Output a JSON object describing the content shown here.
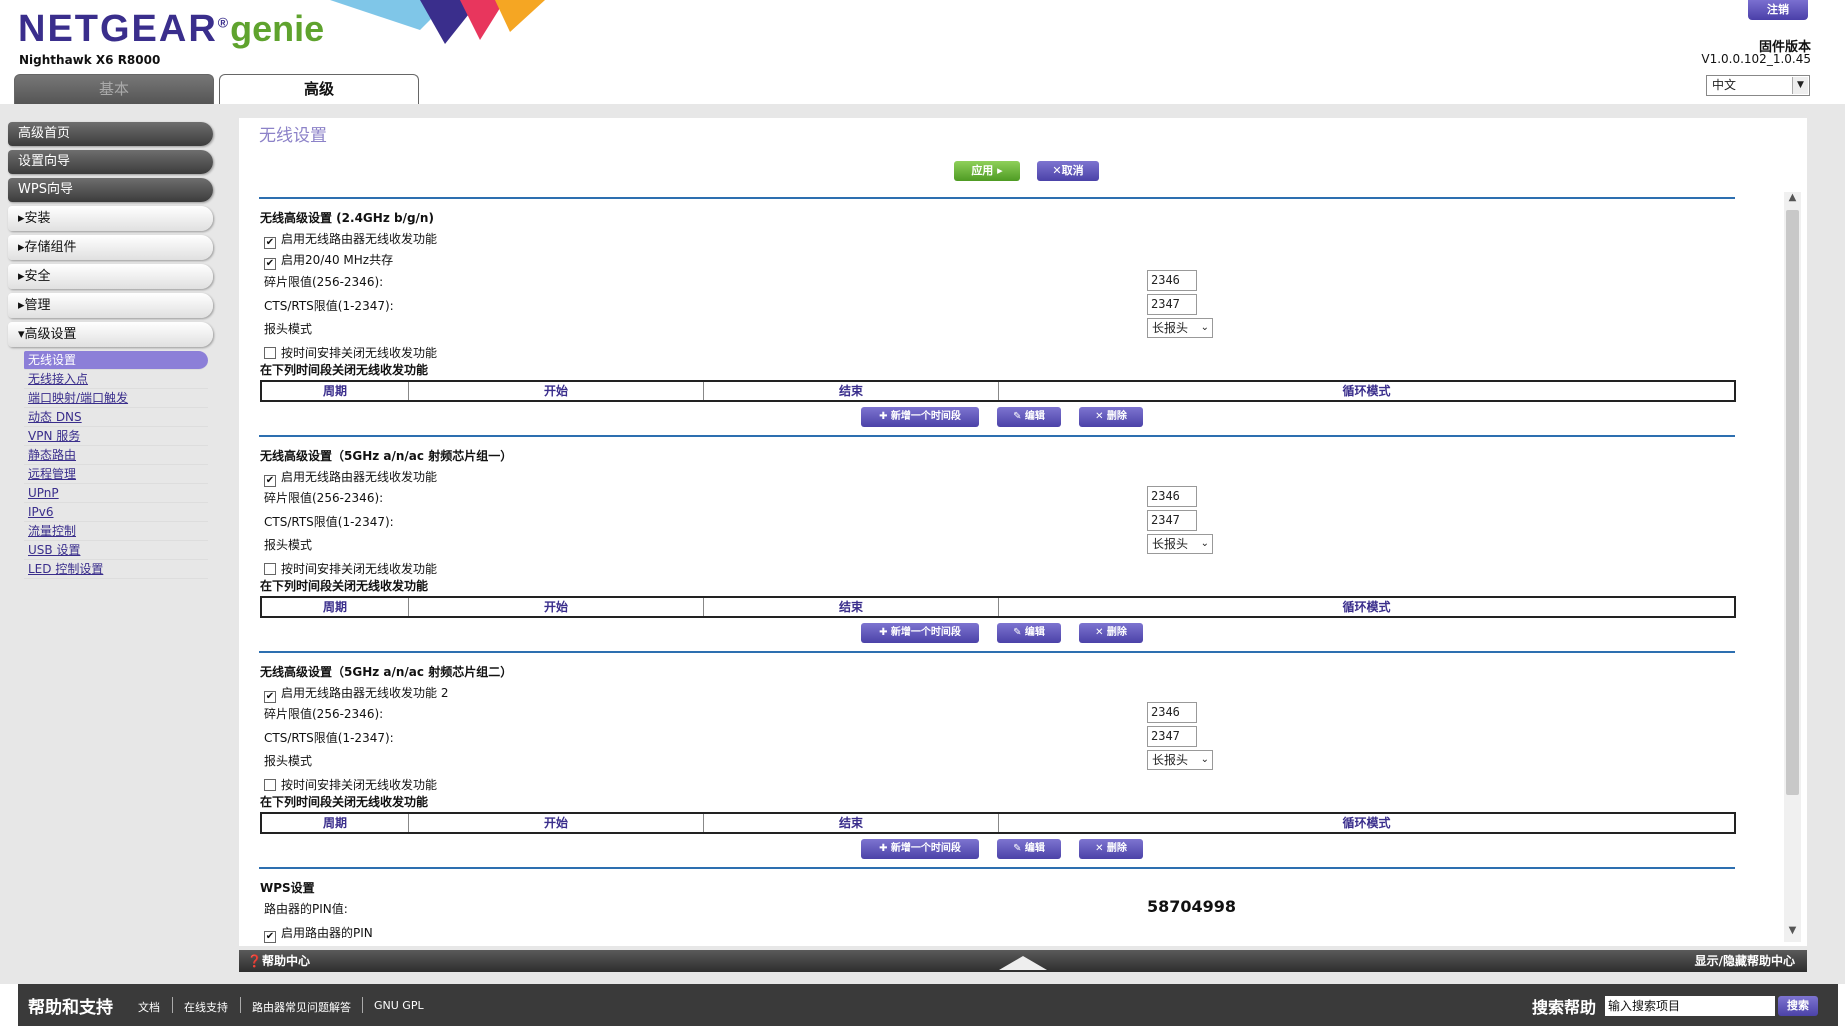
{
  "header": {
    "brand": "NETGEAR",
    "brand_mark": "®",
    "genie": "genie",
    "model": "Nighthawk X6 R8000",
    "tabs": {
      "basic": "基本",
      "advanced": "高级"
    },
    "logout": "注销",
    "firmware_label": "固件版本",
    "firmware_version": "V1.0.0.102_1.0.45",
    "language": "中文"
  },
  "sidebar": {
    "dark_items": [
      "高级首页",
      "设置向导",
      "WPS向导"
    ],
    "light_items": [
      "▸安装",
      "▸存储组件",
      "▸安全",
      "▸管理",
      "▾高级设置"
    ],
    "sub_items": [
      "无线设置",
      "无线接入点",
      "端口映射/端口触发",
      "动态 DNS",
      "VPN 服务",
      "静态路由",
      "远程管理",
      "UPnP",
      "IPv6",
      "流量控制",
      "USB 设置",
      "LED 控制设置"
    ]
  },
  "main": {
    "title": "无线设置",
    "apply": "应用 ▸",
    "cancel": "✕取消",
    "schedule_headers": [
      "周期",
      "开始",
      "结束",
      "循环模式"
    ],
    "add_period": "✚ 新增一个时间段",
    "edit": "✎ 编辑",
    "delete": "✕ 删除",
    "sections": [
      {
        "title": "无线高级设置 (2.4GHz b/g/n)",
        "enable_radio": "启用无线路由器无线收发功能",
        "coexist": "启用20/40 MHz共存",
        "frag_label": "碎片限值(256-2346):",
        "frag_value": "2346",
        "cts_label": "CTS/RTS限值(1-2347):",
        "cts_value": "2347",
        "preamble_label": "报头模式",
        "preamble_value": "长报头",
        "schedule_off": "按时间安排关闭无线收发功能",
        "schedule_title": "在下列时间段关闭无线收发功能"
      },
      {
        "title": "无线高级设置（5GHz a/n/ac 射频芯片组一）",
        "enable_radio": "启用无线路由器无线收发功能",
        "frag_label": "碎片限值(256-2346):",
        "frag_value": "2346",
        "cts_label": "CTS/RTS限值(1-2347):",
        "cts_value": "2347",
        "preamble_label": "报头模式",
        "preamble_value": "长报头",
        "schedule_off": "按时间安排关闭无线收发功能",
        "schedule_title": "在下列时间段关闭无线收发功能"
      },
      {
        "title": "无线高级设置（5GHz a/n/ac 射频芯片组二）",
        "enable_radio": "启用无线路由器无线收发功能 2",
        "frag_label": "碎片限值(256-2346):",
        "frag_value": "2346",
        "cts_label": "CTS/RTS限值(1-2347):",
        "cts_value": "2347",
        "preamble_label": "报头模式",
        "preamble_value": "长报头",
        "schedule_off": "按时间安排关闭无线收发功能",
        "schedule_title": "在下列时间段关闭无线收发功能"
      }
    ],
    "wps": {
      "title": "WPS设置",
      "pin_label": "路由器的PIN值:",
      "pin_value": "58704998",
      "enable_pin": "启用路由器的PIN"
    }
  },
  "help_bar": {
    "left": "帮助中心",
    "right": "显示/隐藏帮助中心"
  },
  "footer": {
    "title": "帮助和支持",
    "links": [
      "文档",
      "在线支持",
      "路由器常见问题解答",
      "GNU GPL"
    ],
    "search_label": "搜索帮助",
    "search_placeholder": "输入搜索项目",
    "search_button": "搜索"
  }
}
